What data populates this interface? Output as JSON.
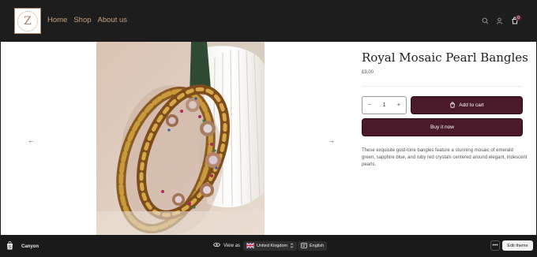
{
  "header": {
    "logo_letter": "Z",
    "nav": [
      {
        "label": "Home"
      },
      {
        "label": "Shop"
      },
      {
        "label": "About us"
      }
    ],
    "cart_count": "0",
    "icons": [
      "search-icon",
      "account-icon",
      "cart-icon"
    ]
  },
  "product": {
    "title": "Royal Mosaic Pearl Bangles",
    "price": "£9.00",
    "quantity": "1",
    "qty_minus": "−",
    "qty_plus": "+",
    "add_to_cart": "Add to cart",
    "buy_now": "Buy it now",
    "description": "These exquisite gold-tone bangles feature a stunning mosaic of emerald green, sapphire blue, and ruby red crystals centered around elegant, iridescent pearls.",
    "prev_arrow": "←",
    "next_arrow": "→"
  },
  "editor_bar": {
    "store_name": "Canyon",
    "view_as_label": "View as",
    "country": "United Kingdom",
    "language": "English",
    "more_label": "•••",
    "edit_theme": "Edit theme"
  },
  "colors": {
    "header_bg": "#1d1d1d",
    "nav_text": "#c9a27e",
    "button_bg": "#4a1a2b",
    "editor_bar_bg": "#1a1a1a"
  }
}
